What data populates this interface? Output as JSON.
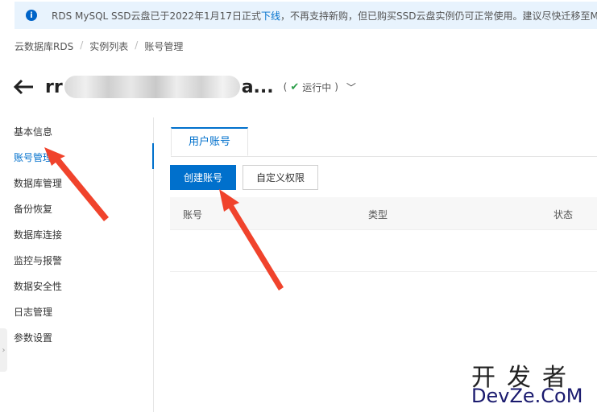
{
  "notice": {
    "prefix": "RDS MySQL SSD云盘已于2022年1月17日正式",
    "link": "下线",
    "suffix": "，不再支持新购，但已购买SSD云盘实例仍可正常使用。建议尽快迁移至My"
  },
  "breadcrumb": [
    "云数据库RDS",
    "实例列表",
    "账号管理"
  ],
  "instance": {
    "name_start": "rr",
    "name_end": "a...",
    "status": "运行中"
  },
  "sidebar": {
    "items": [
      "基本信息",
      "账号管理",
      "数据库管理",
      "备份恢复",
      "数据库连接",
      "监控与报警",
      "数据安全性",
      "日志管理",
      "参数设置"
    ],
    "active_index": 1
  },
  "tabs": [
    "用户账号"
  ],
  "buttons": {
    "create": "创建账号",
    "custom": "自定义权限"
  },
  "table": {
    "columns": [
      "账号",
      "类型",
      "状态"
    ]
  },
  "watermark": {
    "cn": "开发者",
    "en": "DevZe.CoM"
  },
  "colors": {
    "accent": "#0070cc",
    "annotation_arrow": "#f0432c",
    "running": "#2c9e49"
  }
}
